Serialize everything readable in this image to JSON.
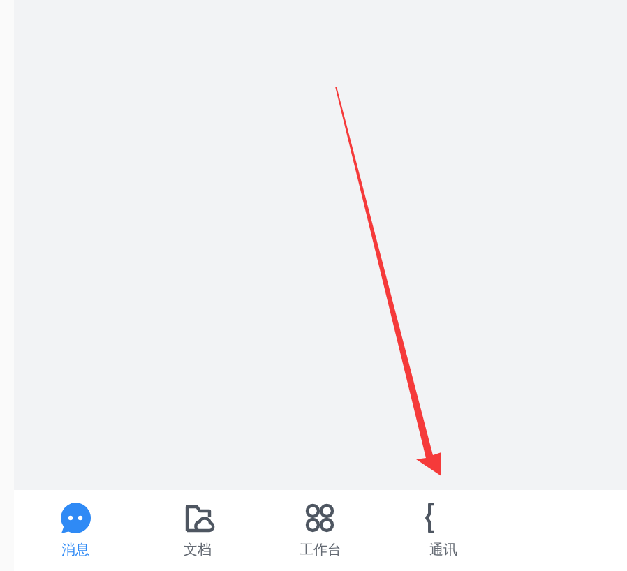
{
  "tab_bar": {
    "tabs": [
      {
        "kind": "chat",
        "label": "消息",
        "selected": true
      },
      {
        "kind": "docs",
        "label": "文档",
        "selected": false
      },
      {
        "kind": "workbench",
        "label": "工作台",
        "selected": false
      },
      {
        "kind": "contacts",
        "label": "通讯",
        "selected": false
      }
    ]
  }
}
